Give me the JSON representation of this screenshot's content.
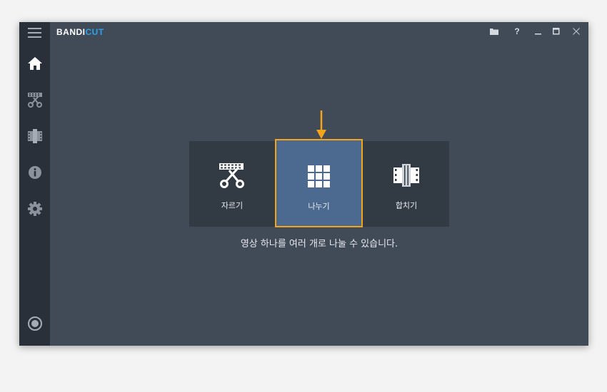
{
  "app": {
    "logo_part1": "BANDI",
    "logo_part2": "CUT"
  },
  "titlebar": {
    "help_label": "?"
  },
  "sidebar": {
    "items": [
      {
        "icon": "home-icon"
      },
      {
        "icon": "scissors-film-icon"
      },
      {
        "icon": "film-merge-icon"
      },
      {
        "icon": "info-icon"
      },
      {
        "icon": "gear-icon"
      }
    ],
    "bottom_icon": "record-icon"
  },
  "cards": [
    {
      "label": "자르기",
      "icon": "cut-icon"
    },
    {
      "label": "나누기",
      "icon": "split-grid-icon",
      "selected": true
    },
    {
      "label": "합치기",
      "icon": "join-film-icon"
    }
  ],
  "description": "영상 하나를 여러 개로 나눌 수 있습니다.",
  "colors": {
    "accent": "#f7a41d",
    "logo_blue": "#2aa3f0",
    "selected_card": "#4c6a8f"
  }
}
